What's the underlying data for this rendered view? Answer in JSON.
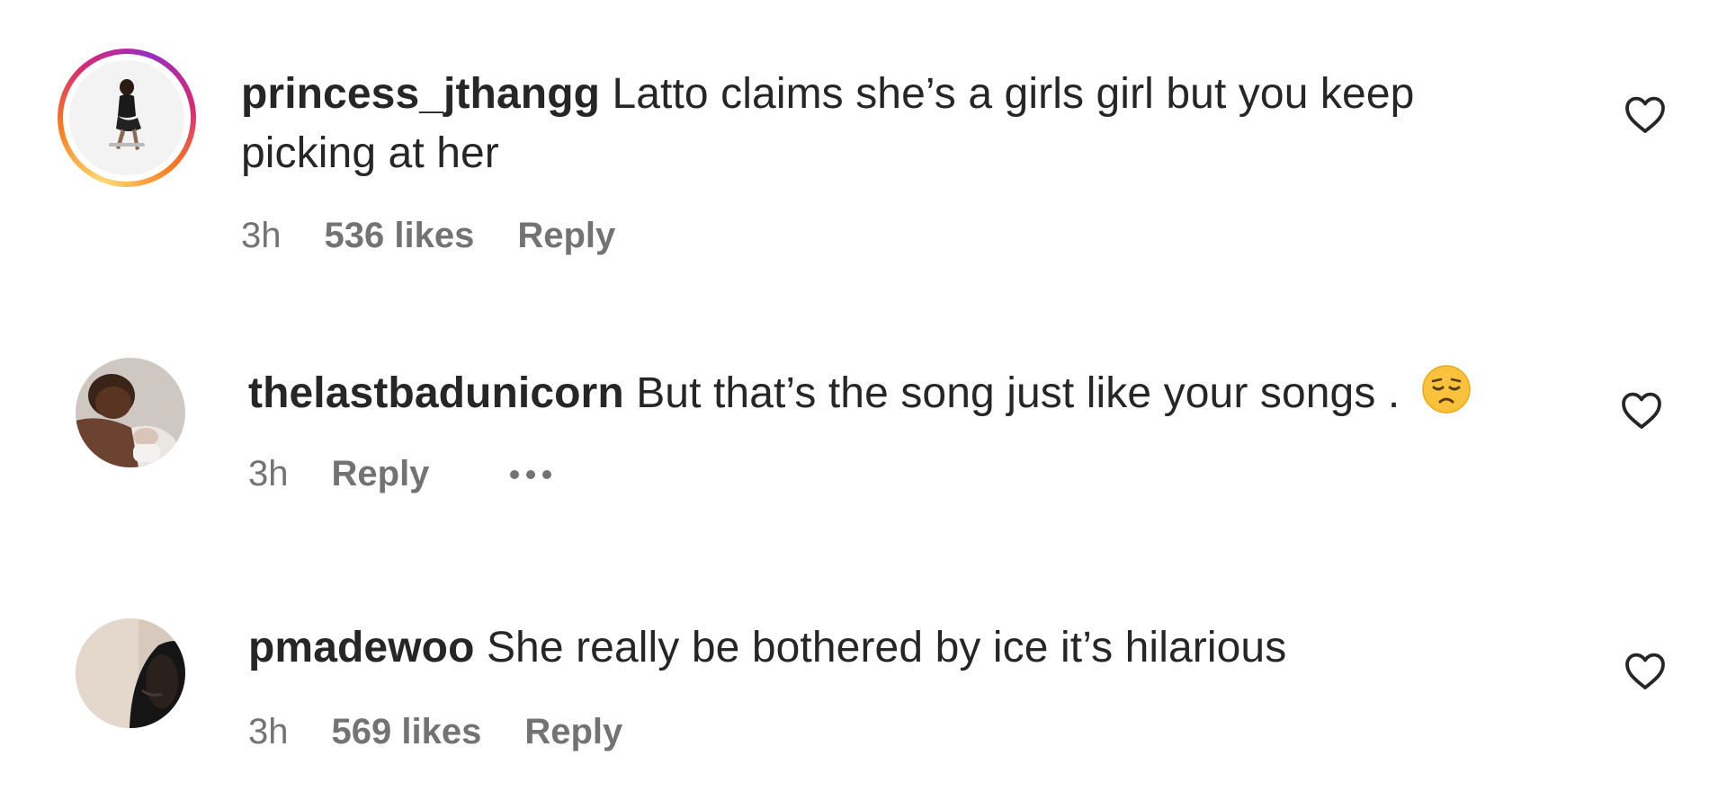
{
  "comments": [
    {
      "username": "princess_jthangg",
      "text_line1": "Latto claims she’s a girls girl but you keep",
      "text_line2": "picking at her",
      "time": "3h",
      "likes": "536 likes",
      "reply": "Reply",
      "has_story_ring": true
    },
    {
      "username": "thelastbadunicorn",
      "text_line1": "But that’s the song just like your songs .",
      "time": "3h",
      "reply": "Reply",
      "emoji": "pensive-face-icon",
      "has_story_ring": false
    },
    {
      "username": "pmadewoo",
      "text_line1": "She really be bothered by ice it’s hilarious",
      "time": "3h",
      "likes": "569 likes",
      "reply": "Reply",
      "has_story_ring": false
    }
  ],
  "colors": {
    "text_primary": "#262626",
    "text_secondary": "#737373",
    "story_ring_start": "#feda75",
    "story_ring_end": "#962fbf"
  }
}
